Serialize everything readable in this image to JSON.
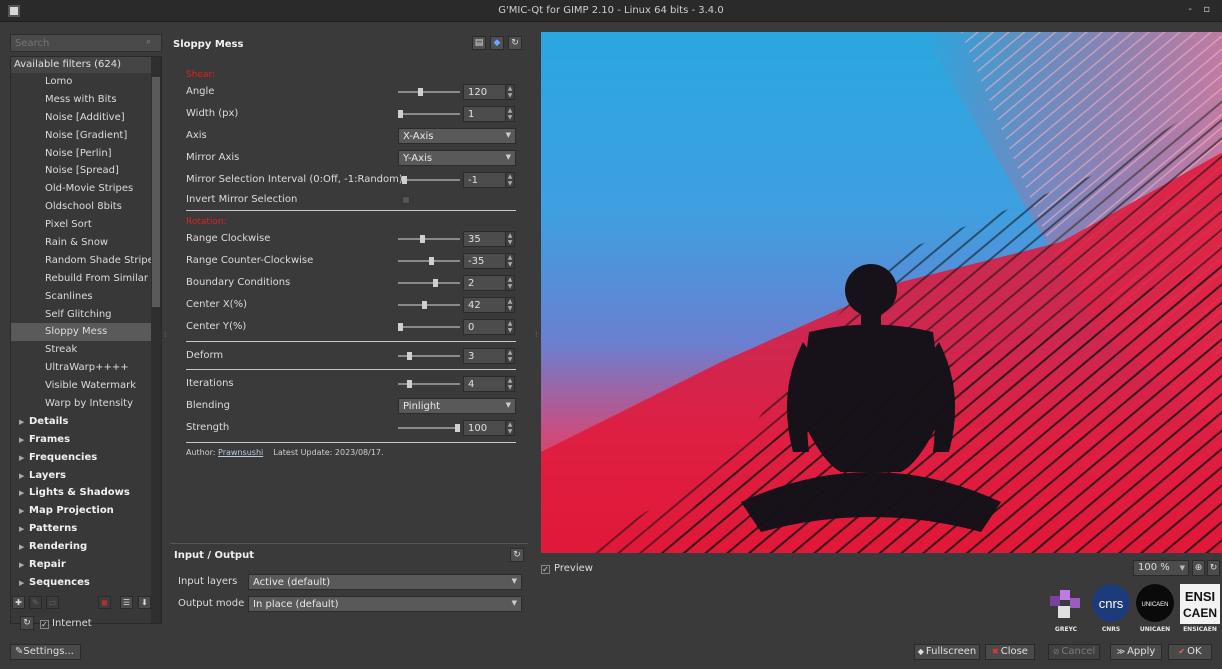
{
  "window": {
    "title": "G'MIC-Qt for GIMP 2.10 - Linux 64 bits - 3.4.0",
    "controls": "- ▫"
  },
  "search": {
    "placeholder": "Search"
  },
  "tree": {
    "header": "Available filters (624)",
    "items": [
      "Lomo",
      "Mess with Bits",
      "Noise [Additive]",
      "Noise [Gradient]",
      "Noise [Perlin]",
      "Noise [Spread]",
      "Old-Movie Stripes",
      "Oldschool 8bits",
      "Pixel Sort",
      "Rain & Snow",
      "Random Shade Stripes",
      "Rebuild From Similar B",
      "Scanlines",
      "Self Glitching",
      "Sloppy Mess",
      "Streak",
      "UltraWarp++++",
      "Visible Watermark",
      "Warp by Intensity"
    ],
    "selected": "Sloppy Mess",
    "categories": [
      "Details",
      "Frames",
      "Frequencies",
      "Layers",
      "Lights & Shadows",
      "Map Projection",
      "Patterns",
      "Rendering",
      "Repair",
      "Sequences"
    ]
  },
  "internet": {
    "label": "Internet",
    "checked": true
  },
  "settings_button": "Settings...",
  "filter": {
    "title": "Sloppy Mess",
    "section_shear": "Shear:",
    "section_rotation": "Rotation:",
    "params": {
      "angle": {
        "label": "Angle",
        "value": "120",
        "level": 0.35
      },
      "width": {
        "label": "Width (px)",
        "value": "1",
        "level": 0.0
      },
      "axis": {
        "label": "Axis",
        "value": "X-Axis"
      },
      "mirror_axis": {
        "label": "Mirror Axis",
        "value": "Y-Axis"
      },
      "mirror_interval": {
        "label": "Mirror Selection Interval (0:Off, -1:Random)",
        "value": "-1",
        "level": 0.0
      },
      "invert_mirror": {
        "label": "Invert Mirror Selection",
        "checked": false
      },
      "range_cw": {
        "label": "Range Clockwise",
        "value": "35",
        "level": 0.38
      },
      "range_ccw": {
        "label": "Range Counter-Clockwise",
        "value": "-35",
        "level": 0.55
      },
      "boundary": {
        "label": "Boundary Conditions",
        "value": "2",
        "level": 0.62
      },
      "center_x": {
        "label": "Center X(%)",
        "value": "42",
        "level": 0.42
      },
      "center_y": {
        "label": "Center Y(%)",
        "value": "0",
        "level": 0.0
      },
      "deform": {
        "label": "Deform",
        "value": "3",
        "level": 0.15
      },
      "iterations": {
        "label": "Iterations",
        "value": "4",
        "level": 0.15
      },
      "blending": {
        "label": "Blending",
        "value": "Pinlight"
      },
      "strength": {
        "label": "Strength",
        "value": "100",
        "level": 1.0
      }
    },
    "author_label": "Author:",
    "author_name": "Prawnsushi",
    "latest_update": "Latest Update: 2023/08/17."
  },
  "io": {
    "title": "Input / Output",
    "input_label": "Input layers",
    "input_value": "Active (default)",
    "output_label": "Output mode",
    "output_value": "In place (default)"
  },
  "preview": {
    "label": "Preview",
    "checked": true,
    "zoom": "100 %"
  },
  "logos": [
    "GREYC",
    "CNRS",
    "UNICAEN",
    "ENSICAEN"
  ],
  "logo_text": {
    "cnrs": "cnrs",
    "unicaen": "UNICAEN",
    "ensi": "ENSI",
    "caen": "CAEN"
  },
  "buttons": {
    "fullscreen": "Fullscreen",
    "close": "Close",
    "cancel": "Cancel",
    "apply": "Apply",
    "ok": "OK"
  }
}
